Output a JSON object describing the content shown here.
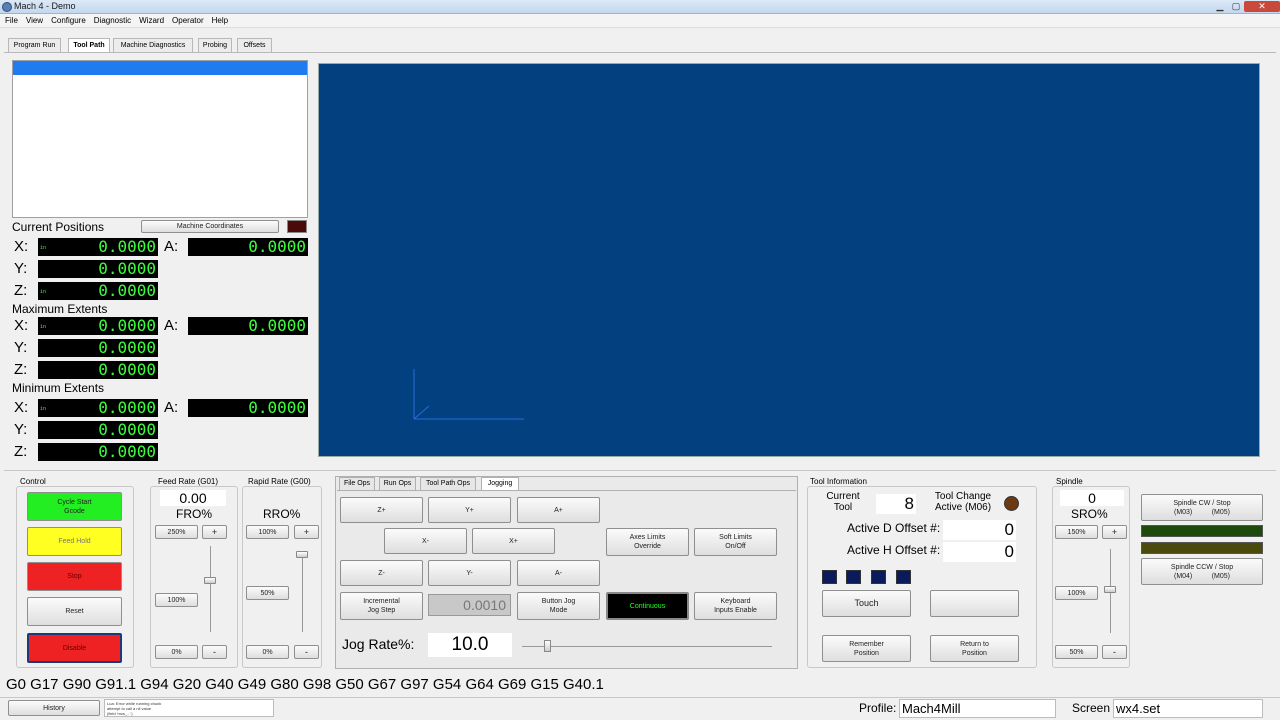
{
  "window": {
    "title": "Mach 4 - Demo",
    "minimize": "▁",
    "maximize": "▢",
    "close": "✕"
  },
  "menu": [
    "File",
    "View",
    "Configure",
    "Diagnostic",
    "Wizard",
    "Operator",
    "Help"
  ],
  "tabs": [
    "Program Run",
    "Tool Path",
    "Machine Diagnostics",
    "Probing",
    "Offsets"
  ],
  "active_tab": "Tool Path",
  "positions": {
    "current_label": "Current Positions",
    "machine_coords_button": "Machine Coordinates",
    "max_label": "Maximum Extents",
    "min_label": "Minimum Extents",
    "axis_x": "X:",
    "axis_y": "Y:",
    "axis_z": "Z:",
    "axis_a": "A:",
    "unit_tag": "in",
    "current": {
      "x": "0.0000",
      "y": "0.0000",
      "z": "0.0000",
      "a": "0.0000"
    },
    "maximum": {
      "x": "0.0000",
      "y": "0.0000",
      "z": "0.0000",
      "a": "0.0000"
    },
    "minimum": {
      "x": "0.0000",
      "y": "0.0000",
      "z": "0.0000",
      "a": "0.0000"
    }
  },
  "control": {
    "title": "Control",
    "cycle_start": "Cycle Start\nGcode",
    "feed_hold": "Feed Hold",
    "stop": "Stop",
    "reset": "Reset",
    "disable": "Disable"
  },
  "feed_rate": {
    "title": "Feed Rate (G01)",
    "value": "0.00",
    "label": "FRO%",
    "preset_high": "250%",
    "plus": "+",
    "preset_mid": "100%",
    "preset_low": "0%",
    "minus": "-",
    "level_percent": 100
  },
  "rapid_rate": {
    "title": "Rapid Rate (G00)",
    "label": "RRO%",
    "preset_high": "100%",
    "plus": "+",
    "preset_mid": "50%",
    "preset_low": "0%",
    "minus": "-",
    "level_percent": 100
  },
  "subtabs": [
    "File Ops",
    "Run Ops",
    "Tool Path Ops",
    "Jogging"
  ],
  "active_subtab": "Jogging",
  "jogging": {
    "z_plus": "Z+",
    "y_plus": "Y+",
    "a_plus": "A+",
    "x_minus": "X-",
    "x_plus": "X+",
    "z_minus": "Z-",
    "y_minus": "Y-",
    "a_minus": "A-",
    "axes_limits": "Axes Limits\nOverride",
    "soft_limits": "Soft Limits\nOn/Off",
    "incremental": "Incremental\nJog Step",
    "increment_value": "0.0010",
    "button_jog": "Button Jog\nMode",
    "continuous": "Continuous",
    "keyboard": "Keyboard\nInputs Enable",
    "jog_rate_label": "Jog Rate%:",
    "jog_rate_value": "10.0"
  },
  "tool_info": {
    "title": "Tool Information",
    "current_tool_label": "Current\nTool",
    "current_tool_value": "8",
    "tool_change_label": "Tool Change\nActive (M06)",
    "d_offset_label": "Active D Offset #:",
    "d_offset_value": "0",
    "h_offset_label": "Active H Offset #:",
    "h_offset_value": "0",
    "touch": "Touch",
    "blank_button": "",
    "remember": "Remember\nPosition",
    "return": "Return to\nPosition"
  },
  "spindle": {
    "title": "Spindle",
    "value": "0",
    "label": "SRO%",
    "preset_high": "150%",
    "plus": "+",
    "preset_mid": "100%",
    "preset_low": "50%",
    "minus": "-",
    "cw_stop": "Spindle CW / Stop\n(M03)          (M05)",
    "ccw_stop": "Spindle CCW / Stop\n(M04)          (M05)",
    "level_percent": 100
  },
  "gcode_status": "G0 G17 G90 G91.1 G94 G20 G40 G49 G80 G98 G50 G67 G97 G54 G64 G69 G15 G40.1",
  "bottom": {
    "history": "History",
    "message": "Lua: Error while running chunk\nattempt to call a nil value\n(field 'mcs_...')",
    "profile_label": "Profile:",
    "profile_value": "Mach4Mill",
    "screen_label": "Screen",
    "screen_value": "wx4.set"
  },
  "colors": {
    "dro_bg": "#000000",
    "dro_text": "#3cff3c",
    "viewport": "#02407f",
    "cycle_start": "#22ee22",
    "feed_hold": "#ffff22",
    "stop": "#ee2222",
    "disable": "#ee2222",
    "continuous_bg": "#000000",
    "continuous_text": "#22ff22"
  }
}
